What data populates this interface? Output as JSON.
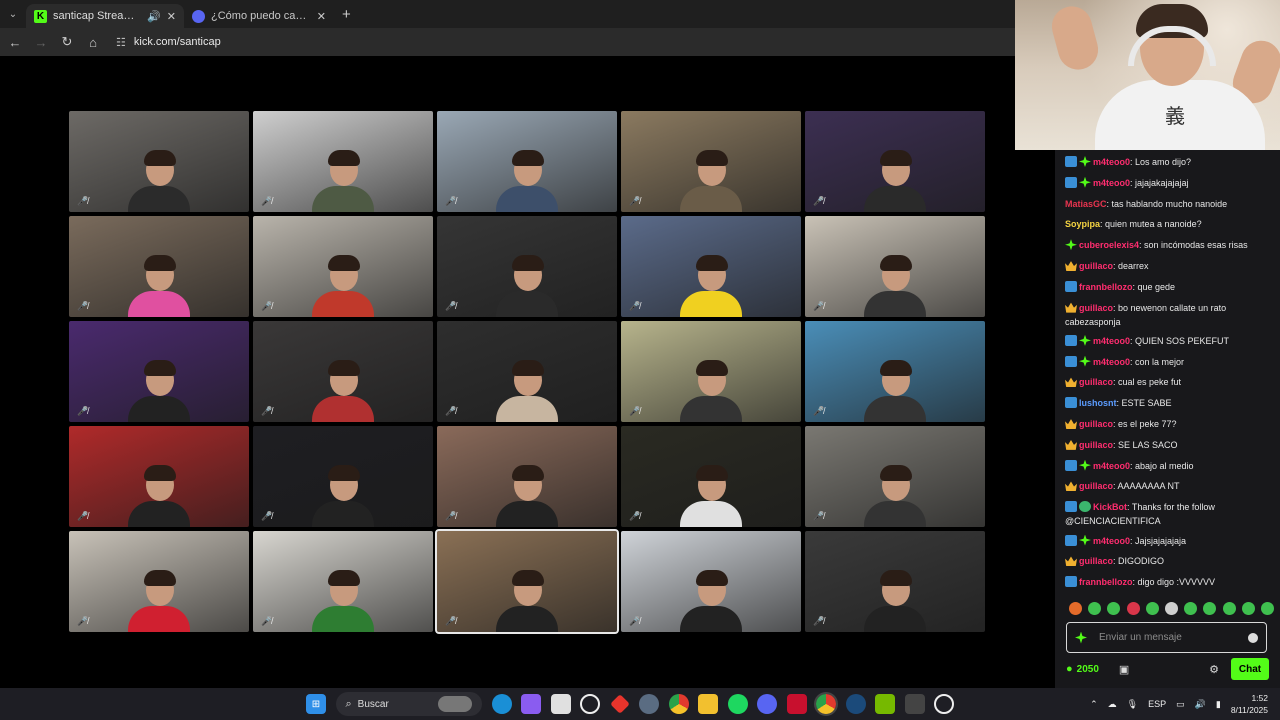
{
  "browser": {
    "tabs": [
      {
        "title": "santicap Stream - Watch Li",
        "active": true
      },
      {
        "title": "¿Cómo puedo cambiar mi nom",
        "active": false
      }
    ],
    "url": "kick.com/santicap"
  },
  "chat": {
    "messages": [
      {
        "badges": [
          "prime",
          "sub"
        ],
        "user": "m4teoo0",
        "color": "#ff2d6f",
        "text": ": Los amo dijo?"
      },
      {
        "badges": [
          "prime",
          "sub"
        ],
        "user": "m4teoo0",
        "color": "#ff2d6f",
        "text": ": jajajakajajajaj"
      },
      {
        "badges": [],
        "user": "MatiasGC",
        "color": "#e8344f",
        "text": ": tas hablando mucho nanoide"
      },
      {
        "badges": [],
        "user": "Soypipa",
        "color": "#f5d442",
        "text": ": quien mutea a nanoide?"
      },
      {
        "badges": [
          "sub"
        ],
        "user": "cuberoelexis4",
        "color": "#ff2d6f",
        "text": ": son incómodas esas risas"
      },
      {
        "badges": [
          "crown"
        ],
        "user": "guillaco",
        "color": "#ff2d6f",
        "text": ": dearrex"
      },
      {
        "badges": [
          "prime"
        ],
        "user": "frannbellozo",
        "color": "#ff2d6f",
        "text": ": que gede"
      },
      {
        "badges": [
          "crown"
        ],
        "user": "guillaco",
        "color": "#ff2d6f",
        "text": ": bo newenon callate un rato cabezasponja"
      },
      {
        "badges": [
          "prime",
          "sub"
        ],
        "user": "m4teoo0",
        "color": "#ff2d6f",
        "text": ": QUIEN SOS PEKEFUT"
      },
      {
        "badges": [
          "prime",
          "sub"
        ],
        "user": "m4teoo0",
        "color": "#ff2d6f",
        "text": ": con la mejor"
      },
      {
        "badges": [
          "crown"
        ],
        "user": "guillaco",
        "color": "#ff2d6f",
        "text": ": cual es peke fut"
      },
      {
        "badges": [
          "prime"
        ],
        "user": "lushosnt",
        "color": "#5b9cff",
        "text": ": ESTE SABE"
      },
      {
        "badges": [
          "crown"
        ],
        "user": "guillaco",
        "color": "#ff2d6f",
        "text": ": es el peke 77?"
      },
      {
        "badges": [
          "crown"
        ],
        "user": "guillaco",
        "color": "#ff2d6f",
        "text": ": SE LAS SACO"
      },
      {
        "badges": [
          "prime",
          "sub"
        ],
        "user": "m4teoo0",
        "color": "#ff2d6f",
        "text": ": abajo al medio"
      },
      {
        "badges": [
          "crown"
        ],
        "user": "guillaco",
        "color": "#ff2d6f",
        "text": ": AAAAAAAA NT"
      },
      {
        "badges": [
          "prime",
          "verify"
        ],
        "user": "KickBot",
        "color": "#ff2d6f",
        "text": ": Thanks for the follow @CIENCIACIENTIFICA"
      },
      {
        "badges": [
          "prime",
          "sub"
        ],
        "user": "m4teoo0",
        "color": "#ff2d6f",
        "text": ": Jajsjajajajaja"
      },
      {
        "badges": [
          "crown"
        ],
        "user": "guillaco",
        "color": "#ff2d6f",
        "text": ": DIGODIGO"
      },
      {
        "badges": [
          "prime"
        ],
        "user": "frannbellozo",
        "color": "#ff2d6f",
        "text": ": digo digo :VVVVVV"
      }
    ],
    "input_placeholder": "Enviar un mensaje",
    "points": "2050",
    "send_label": "Chat"
  },
  "taskbar": {
    "search_label": "Buscar",
    "lang": "ESP",
    "time": "1:52",
    "date": "8/11/2025"
  },
  "colors": {
    "kick_green": "#53fc18",
    "chat_bg": "#18181b"
  }
}
